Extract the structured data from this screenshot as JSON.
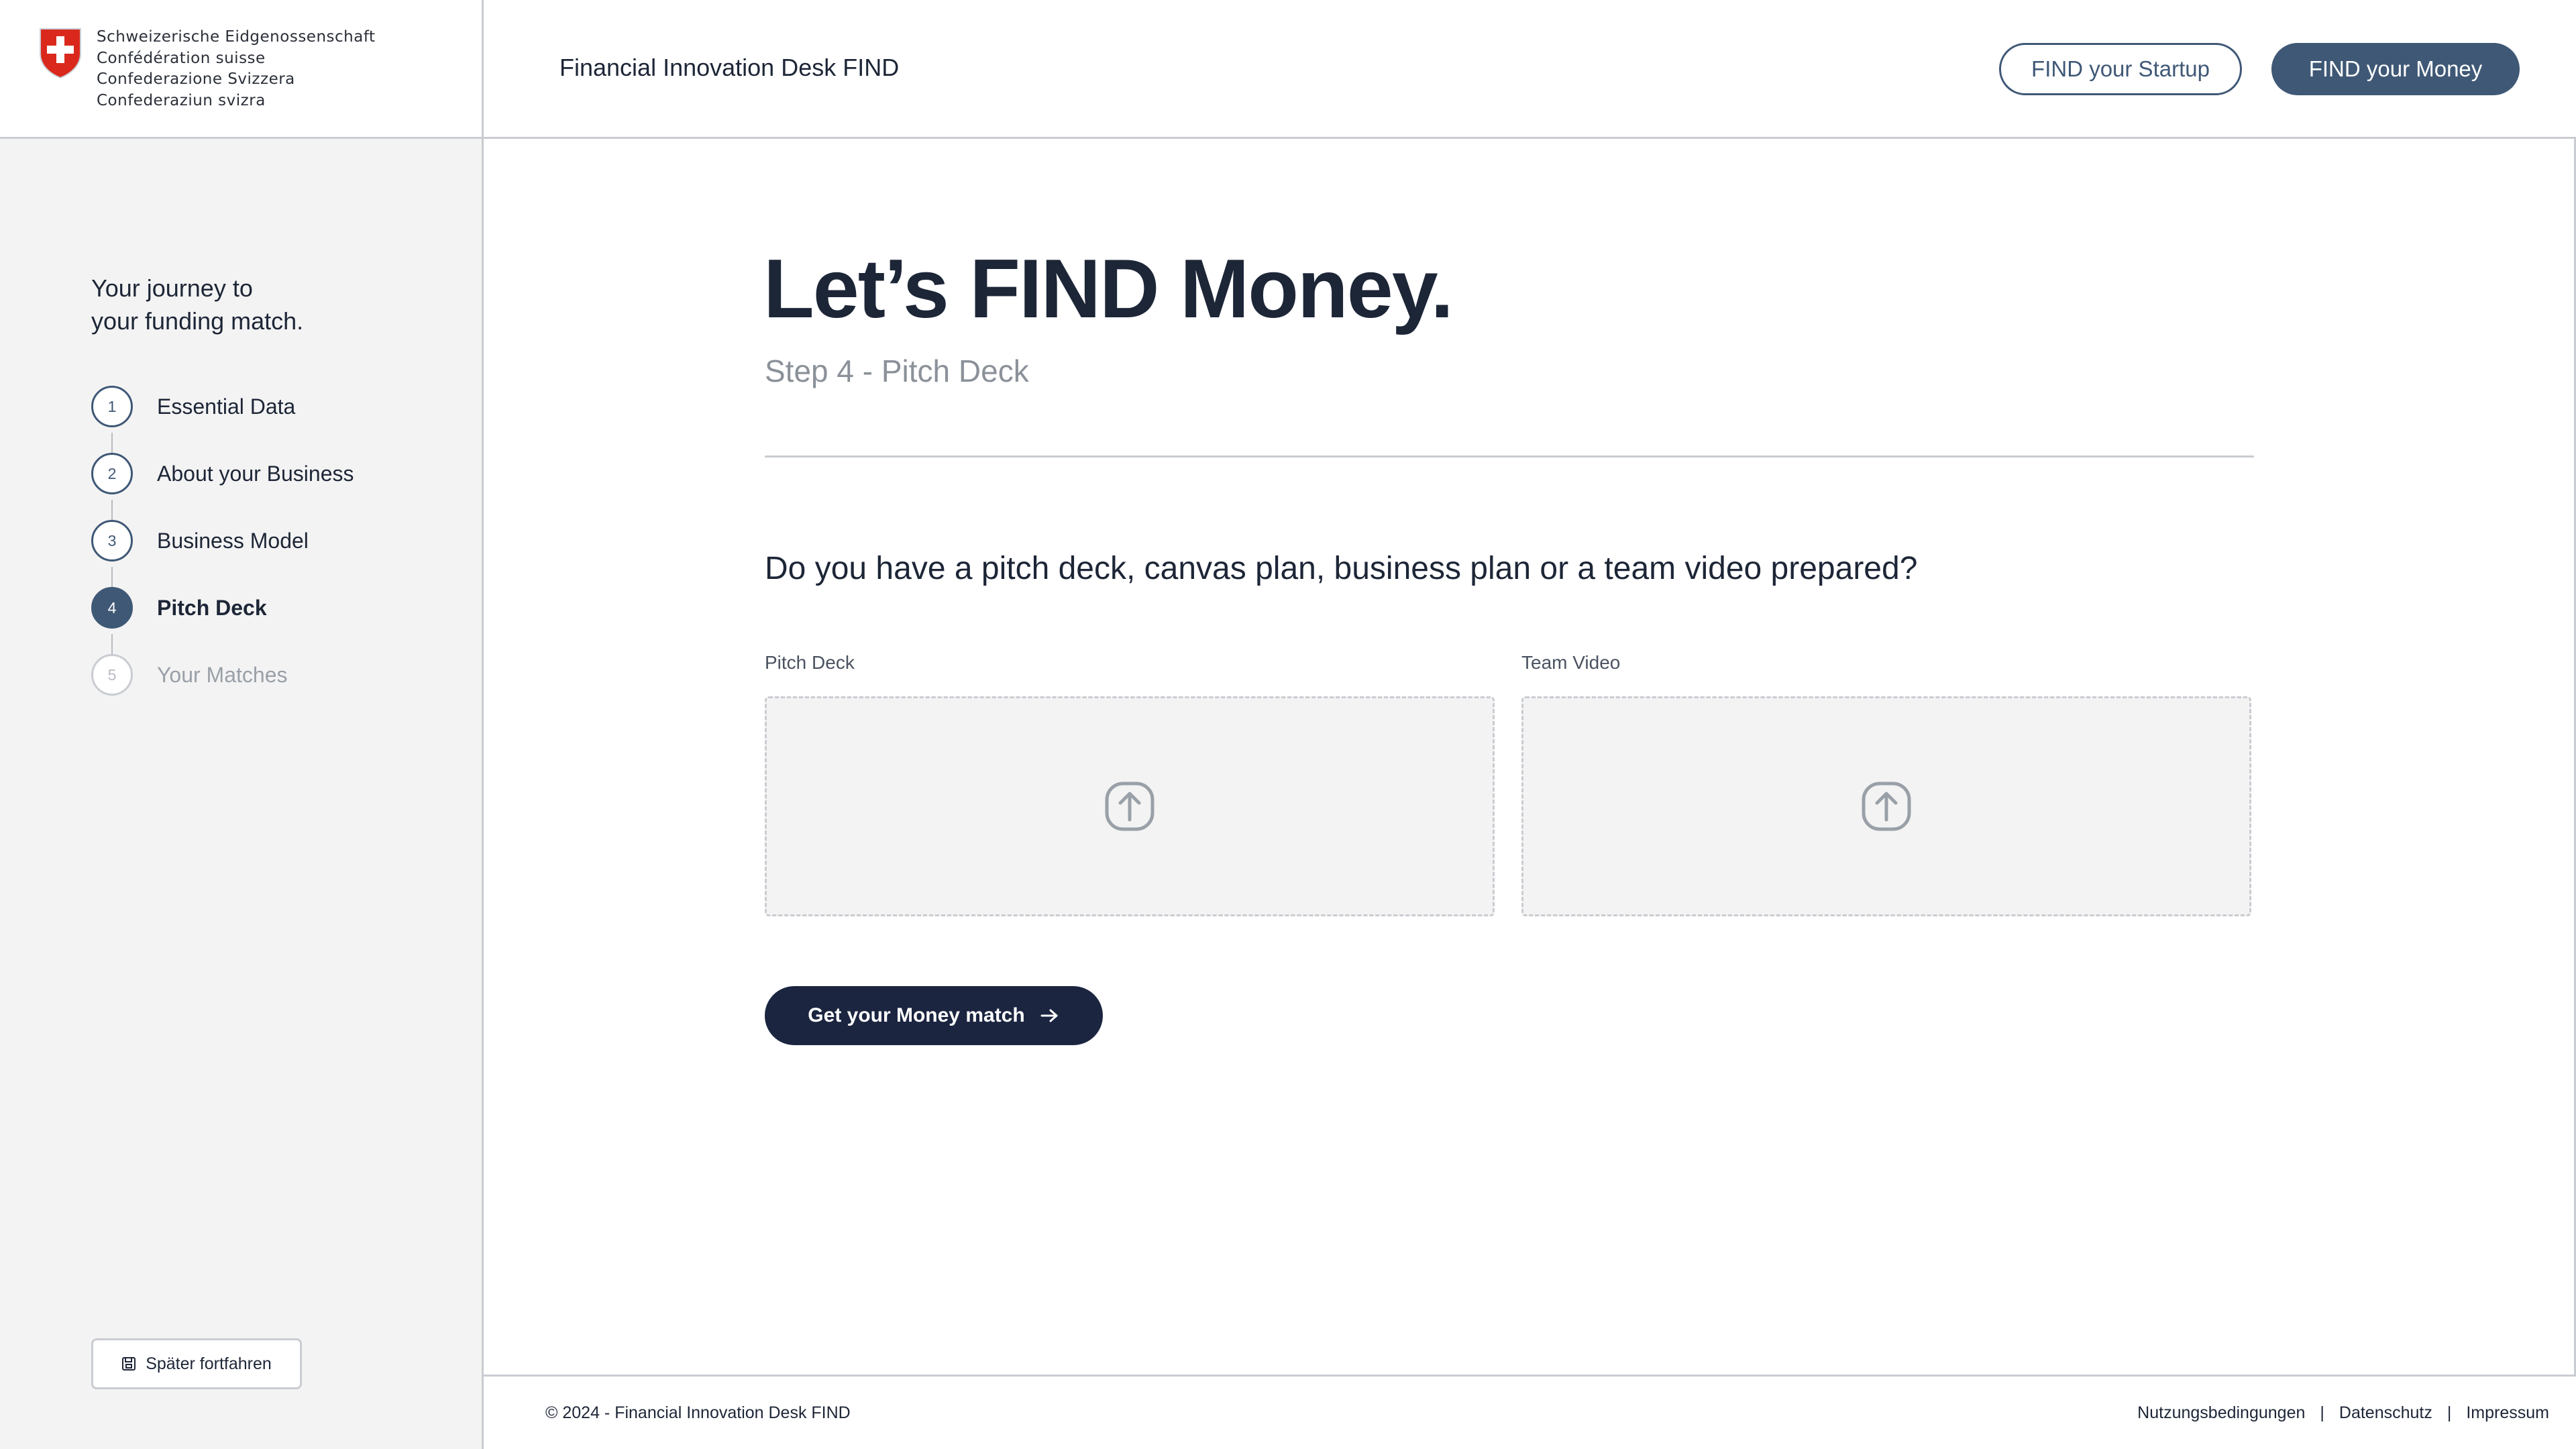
{
  "header": {
    "gov_lines": [
      "Schweizerische Eidgenossenschaft",
      "Confédération suisse",
      "Confederazione Svizzera",
      "Confederaziun svizra"
    ],
    "app_title": "Financial Innovation Desk FIND",
    "btn_startup": "FIND your Startup",
    "btn_money": "FIND your Money"
  },
  "sidebar": {
    "journey_title": "Your journey to\nyour funding match.",
    "steps": [
      {
        "number": "1",
        "label": "Essential Data",
        "state": "done"
      },
      {
        "number": "2",
        "label": "About your Business",
        "state": "done"
      },
      {
        "number": "3",
        "label": "Business Model",
        "state": "done"
      },
      {
        "number": "4",
        "label": "Pitch Deck",
        "state": "active"
      },
      {
        "number": "5",
        "label": "Your Matches",
        "state": "disabled"
      }
    ],
    "later_button": "Später fortfahren"
  },
  "main": {
    "title": "Let’s FIND Money.",
    "subtitle": "Step 4 - Pitch Deck",
    "question": "Do you have a pitch deck, canvas plan, business plan or a team video prepared?",
    "uploads": [
      {
        "label": "Pitch Deck",
        "icon": "upload-icon"
      },
      {
        "label": "Team Video",
        "icon": "upload-icon"
      }
    ],
    "cta": "Get your Money match"
  },
  "footer": {
    "copyright": "© 2024 - Financial Innovation Desk FIND",
    "links": [
      "Nutzungsbedingungen",
      "Datenschutz",
      "Impressum"
    ],
    "separator": "|"
  },
  "colors": {
    "primary": "#3f5876",
    "dark": "#1b2540",
    "sidebar_bg": "#f3f3f3",
    "border": "#c9ccd1",
    "swiss_red": "#da291c"
  }
}
